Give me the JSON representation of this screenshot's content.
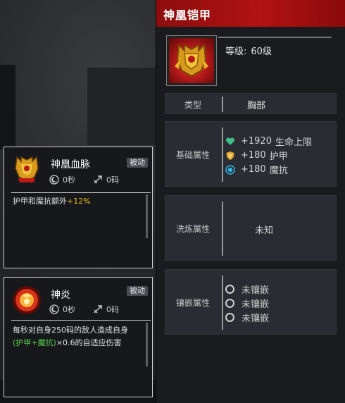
{
  "equipment": {
    "name": "神凰铠甲",
    "level_label": "等级",
    "level_sep": ":",
    "level_value": "60级",
    "icon": "golden-armor-icon",
    "type_label": "类型",
    "type_value": "胸部",
    "base_label": "基础属性",
    "base_stats": [
      {
        "icon": "heart-icon",
        "value": "+1920",
        "name": "生命上限",
        "color": "#3fc08a"
      },
      {
        "icon": "shield-icon",
        "value": "+180",
        "name": "护甲",
        "color": "#e0a530"
      },
      {
        "icon": "magic-resist-icon",
        "value": "+180",
        "name": "魔抗",
        "color": "#2fb6e6"
      }
    ],
    "refine_label": "洗炼属性",
    "refine_value": "未知",
    "socket_label": "镶嵌属性",
    "sockets": [
      "未镶嵌",
      "未镶嵌",
      "未镶嵌"
    ],
    "accent_color": "#b11212"
  },
  "skills": [
    {
      "name": "神凰血脉",
      "badge": "被动",
      "icon": "armor-bloodline-icon",
      "cooldown": "0秒",
      "range": "0码",
      "desc_plain": "护甲和魔抗额外",
      "desc_highlight": "+12%",
      "desc_line2": "",
      "desc_line2_green": "",
      "desc_line2_rest": ""
    },
    {
      "name": "神炎",
      "badge": "被动",
      "icon": "divine-flame-icon",
      "cooldown": "0秒",
      "range": "0码",
      "desc_plain": "每秒对自身250码的敌人造成自身",
      "desc_highlight": "",
      "desc_line2_green": "(护甲+魔抗)",
      "desc_line2_rest": "×0.6的自适应伤害"
    }
  ]
}
